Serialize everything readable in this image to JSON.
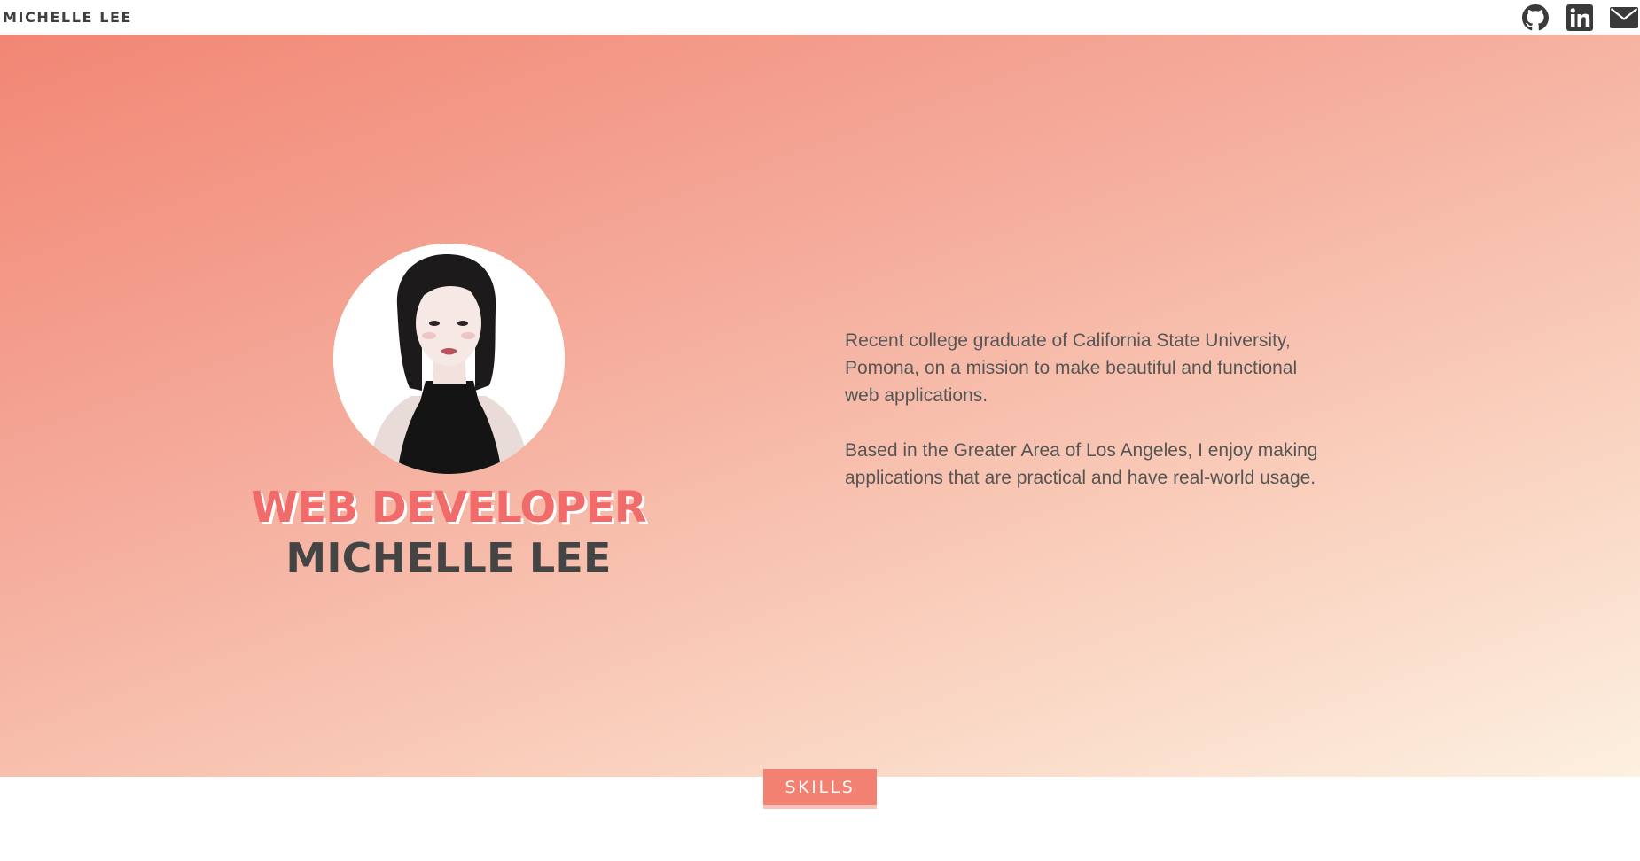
{
  "nav": {
    "brand": "MICHELLE LEE",
    "social_icons": [
      "github-icon",
      "linkedin-icon",
      "mail-icon"
    ]
  },
  "hero": {
    "role": "WEB DEVELOPER",
    "name": "MICHELLE LEE",
    "bio": [
      "Recent college graduate of California State University, Pomona, on a mission to make beautiful and functional web applications.",
      "Based in the Greater Area of Los Angeles, I enjoy making applications that are practical and have real-world usage."
    ]
  },
  "sections": {
    "skills_label": "SKILLS"
  },
  "colors": {
    "gradient_start": "#f28674",
    "gradient_end": "#fdf0e0",
    "accent": "#f26b6b",
    "heading_dark": "#444444",
    "skills_tab": "#f28172"
  }
}
